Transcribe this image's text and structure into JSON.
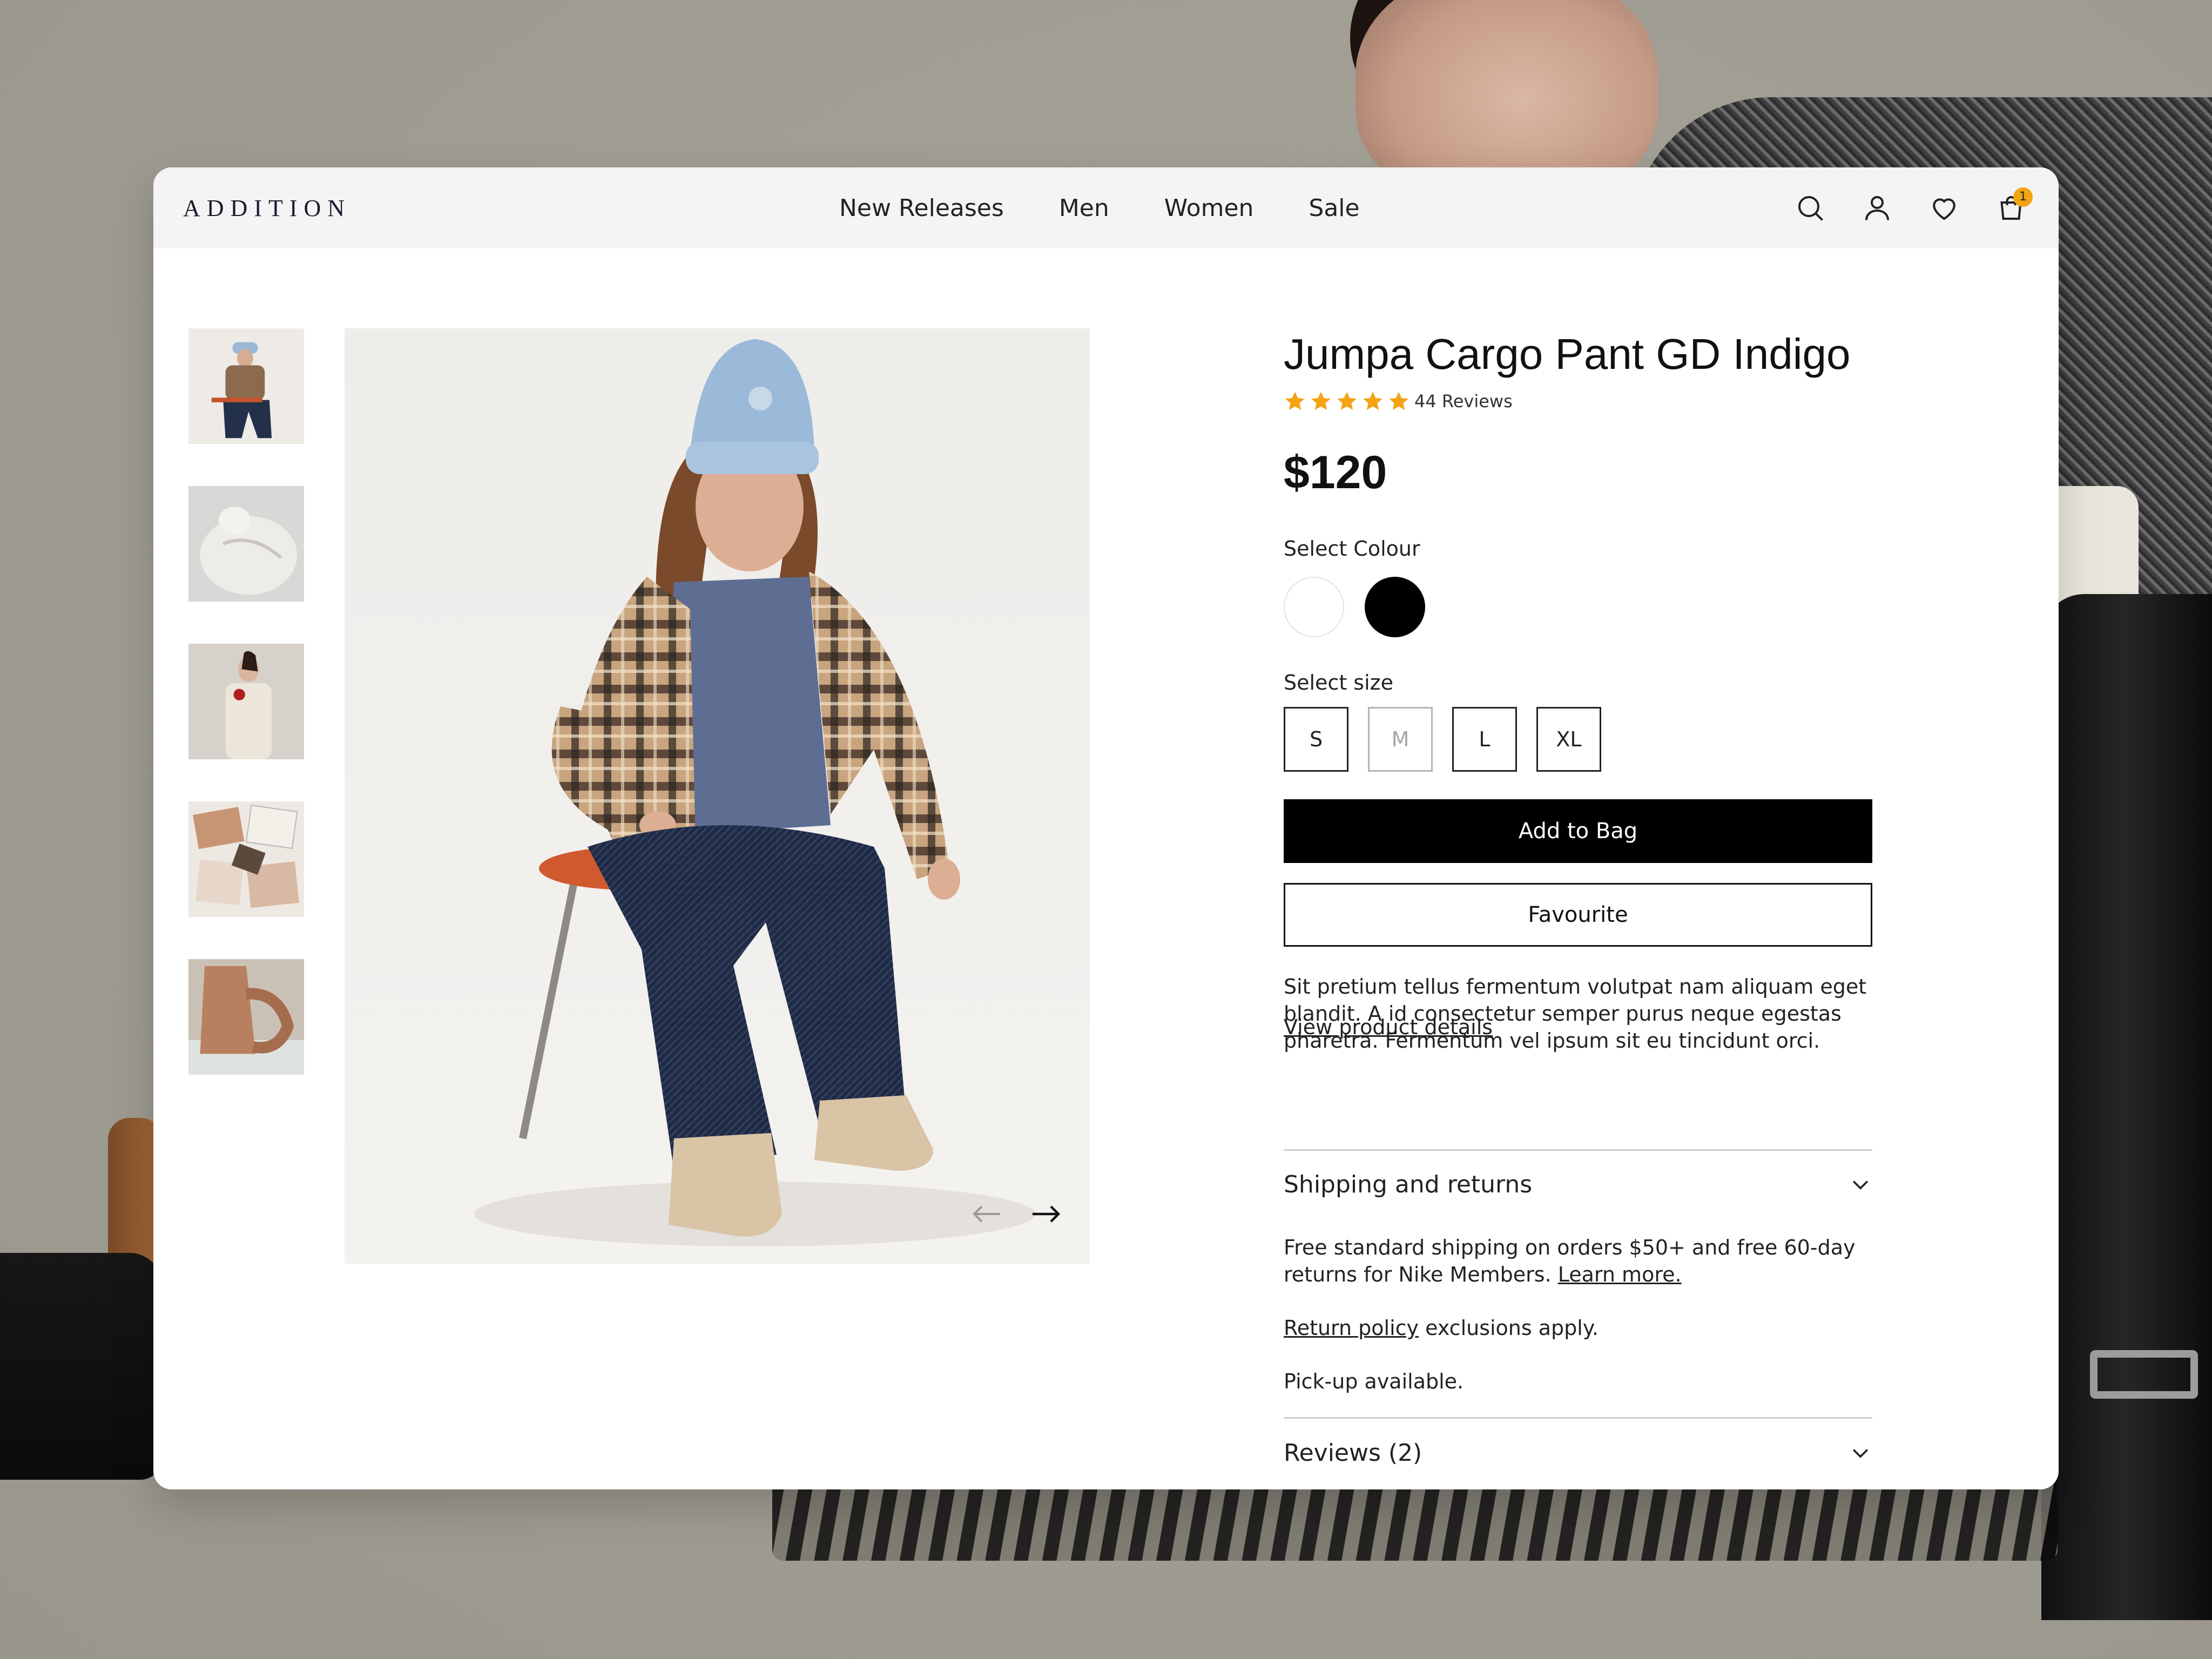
{
  "brand": {
    "logo": "ADDITION"
  },
  "nav": {
    "links": [
      "New Releases",
      "Men",
      "Women",
      "Sale"
    ],
    "icons": [
      "search-icon",
      "user-icon",
      "heart-icon",
      "bag-icon"
    ],
    "cart_count": "1"
  },
  "gallery": {
    "thumbnails": [
      "thumbnail-1",
      "thumbnail-2",
      "thumbnail-3",
      "thumbnail-4",
      "thumbnail-5"
    ],
    "prev_icon": "arrow-left-icon",
    "next_icon": "arrow-right-icon"
  },
  "product": {
    "title": "Jumpa Cargo Pant GD Indigo",
    "rating_stars": 5,
    "reviews_label": "44 Reviews",
    "price": "$120",
    "colour_label": "Select Colour",
    "colours": [
      {
        "name": "white",
        "hex": "#ffffff"
      },
      {
        "name": "black",
        "hex": "#000000"
      }
    ],
    "size_label": "Select size",
    "sizes": [
      {
        "label": "S",
        "available": true
      },
      {
        "label": "M",
        "available": false
      },
      {
        "label": "L",
        "available": true
      },
      {
        "label": "XL",
        "available": true
      }
    ],
    "add_to_bag": "Add to Bag",
    "favourite": "Favourite",
    "description": "Sit pretium tellus fermentum volutpat nam aliquam eget blandit. A id consectetur semper purus neque egestas pharetra. Fermentum vel ipsum sit eu tincidunt orci.",
    "view_details": "View product details"
  },
  "shipping": {
    "title": "Shipping and returns",
    "line1": "Free standard shipping on orders $50+ and free 60-day returns for Nike Members.",
    "learn_more": "Learn more.",
    "return_policy": "Return policy",
    "exclusions": "exclusions apply.",
    "pickup": "Pick-up available."
  },
  "reviews": {
    "title": "Reviews (2)"
  },
  "colors": {
    "accent_star": "#f2a413",
    "badge": "#f2a413",
    "primary_button": "#000000"
  }
}
